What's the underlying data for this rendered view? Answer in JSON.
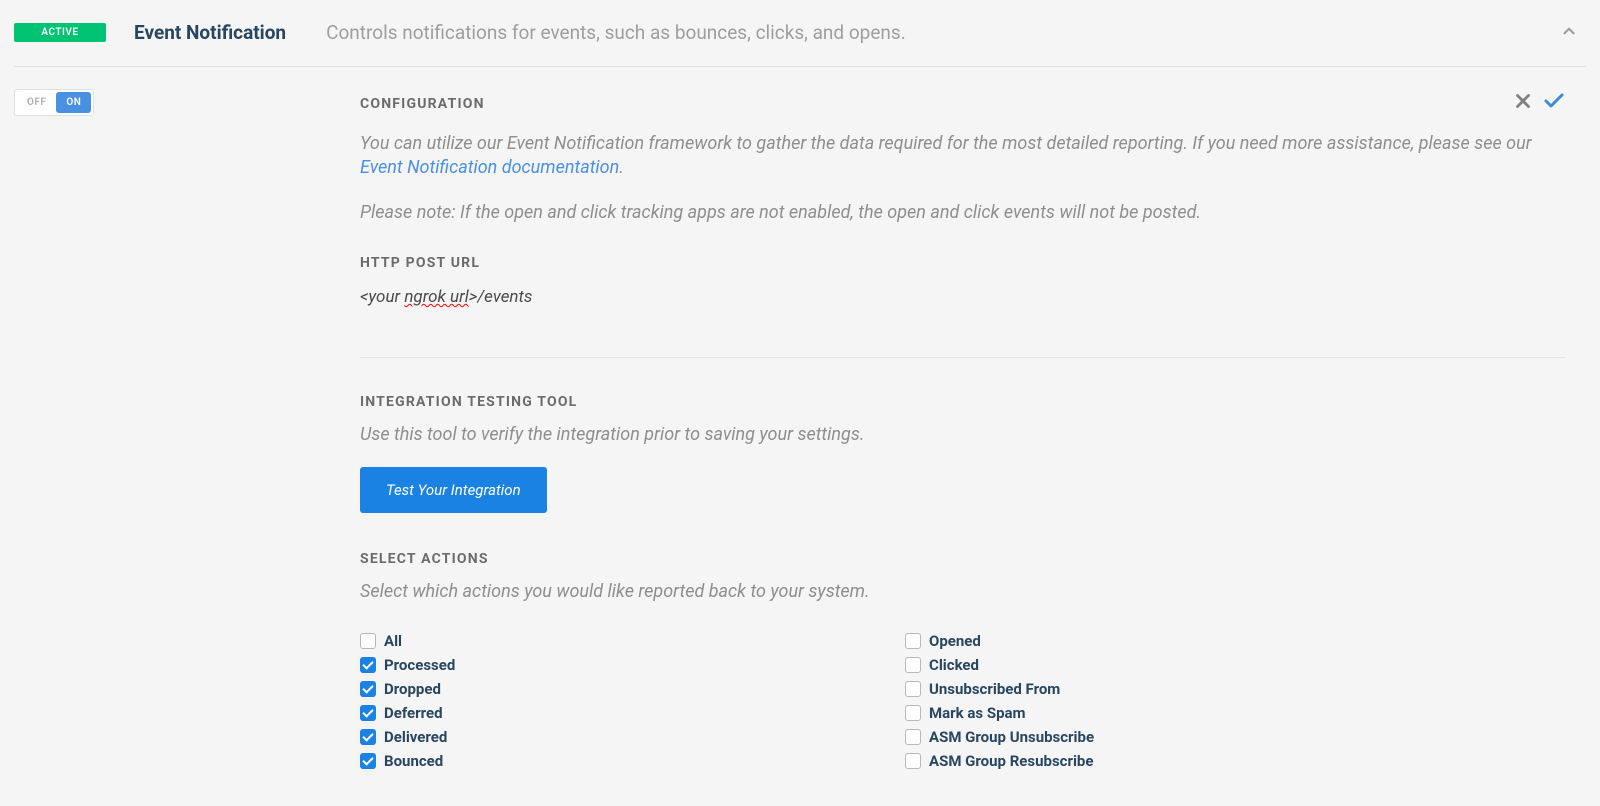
{
  "header": {
    "badge": "ACTIVE",
    "title": "Event Notification",
    "description": "Controls notifications for events, such as bounces, clicks, and opens."
  },
  "toggle": {
    "off": "OFF",
    "on": "ON"
  },
  "configuration": {
    "title": "CONFIGURATION",
    "desc_prefix": "You can utilize our Event Notification framework to gather the data required for the most detailed reporting. If you need more assistance, please see our ",
    "link_text": "Event Notification documentation",
    "desc_suffix": ".",
    "note": "Please note: If the open and click tracking apps are not enabled, the open and click events will not be posted."
  },
  "http_post": {
    "title": "HTTP POST URL",
    "url_prefix": "<your ",
    "url_ngrok": "ngrok url",
    "url_suffix": ">/events"
  },
  "integration": {
    "title": "INTEGRATION TESTING TOOL",
    "help": "Use this tool to verify the integration prior to saving your settings.",
    "button": "Test Your Integration"
  },
  "select_actions": {
    "title": "SELECT ACTIONS",
    "help": "Select which actions you would like reported back to your system.",
    "left": [
      {
        "label": "All",
        "checked": false
      },
      {
        "label": "Processed",
        "checked": true
      },
      {
        "label": "Dropped",
        "checked": true
      },
      {
        "label": "Deferred",
        "checked": true
      },
      {
        "label": "Delivered",
        "checked": true
      },
      {
        "label": "Bounced",
        "checked": true
      }
    ],
    "right": [
      {
        "label": "Opened",
        "checked": false
      },
      {
        "label": "Clicked",
        "checked": false
      },
      {
        "label": "Unsubscribed From",
        "checked": false
      },
      {
        "label": "Mark as Spam",
        "checked": false
      },
      {
        "label": "ASM Group Unsubscribe",
        "checked": false
      },
      {
        "label": "ASM Group Resubscribe",
        "checked": false
      }
    ]
  }
}
